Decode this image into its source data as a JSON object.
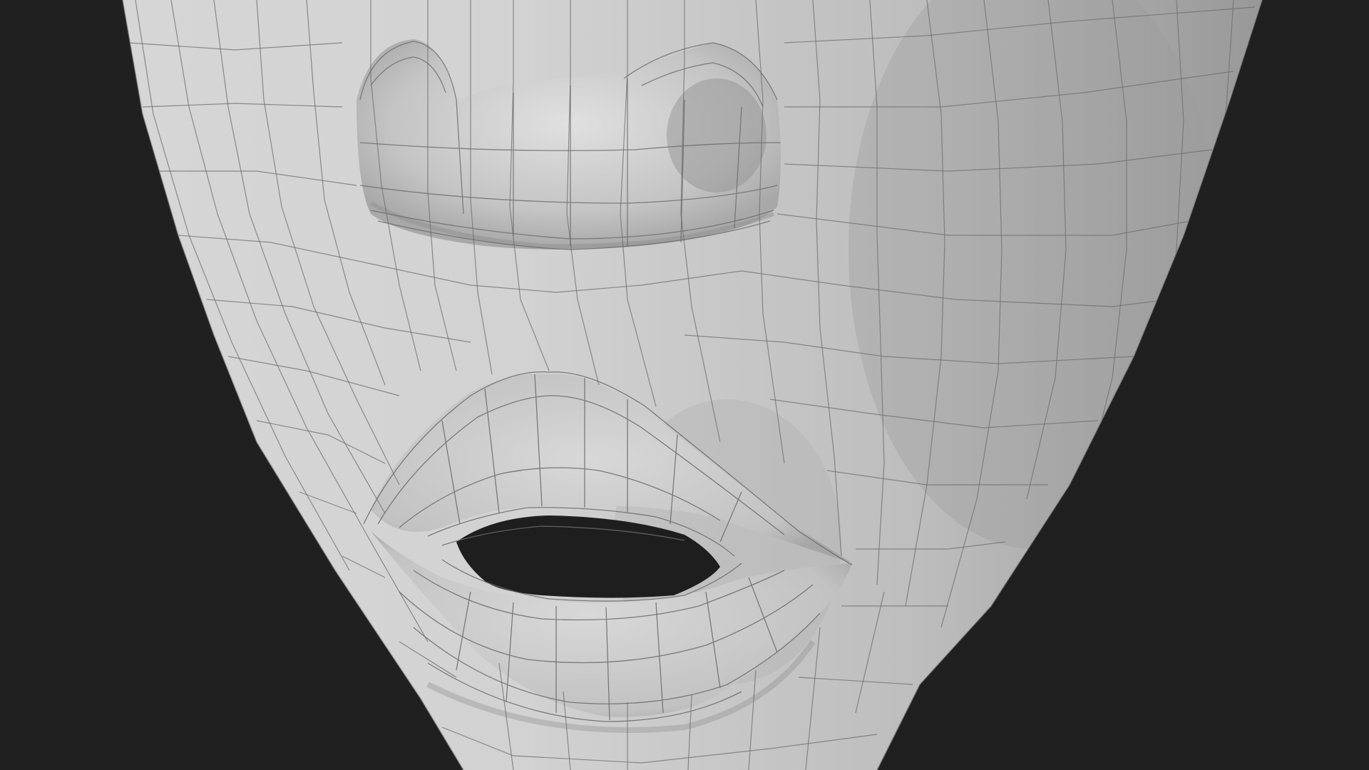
{
  "viewport": {
    "subject": "wireframe-face-mesh",
    "colors": {
      "background": "#202020",
      "skin_light": "#d4d4d4",
      "skin_mid": "#bdbdbd",
      "skin_shadow": "#9a9a9a",
      "wire": "#6e6e6e",
      "cavity": "#1e1e1e"
    }
  }
}
